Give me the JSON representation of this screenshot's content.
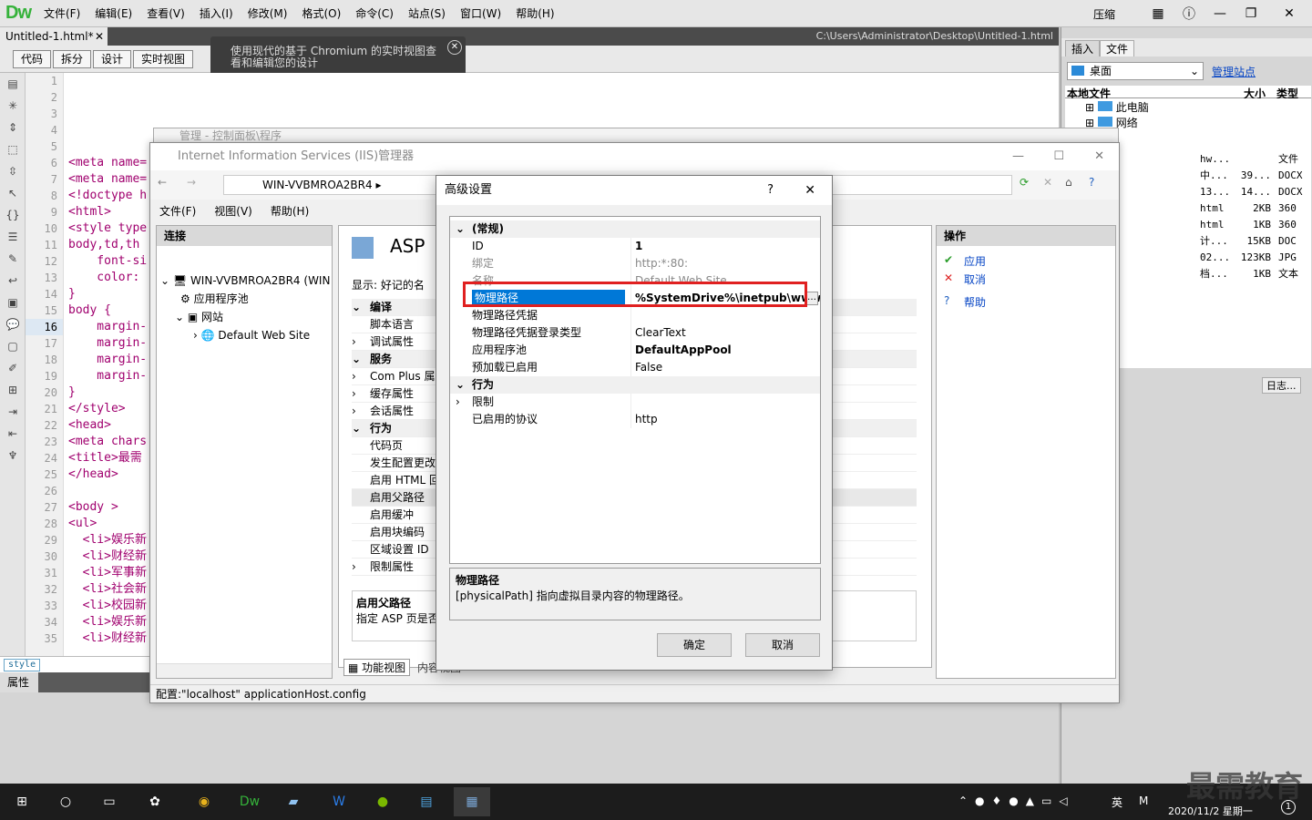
{
  "dw": {
    "logo": "Dw",
    "menu": [
      "文件(F)",
      "编辑(E)",
      "查看(V)",
      "插入(I)",
      "修改(M)",
      "格式(O)",
      "命令(C)",
      "站点(S)",
      "窗口(W)",
      "帮助(H)"
    ],
    "workspace": "压缩",
    "doc_tab": "Untitled-1.html*",
    "doc_path": "C:\\Users\\Administrator\\Desktop\\Untitled-1.html",
    "views": [
      "代码",
      "拆分",
      "设计",
      "实时视图"
    ],
    "tooltip": "使用现代的基于 Chromium 的实时视图查看和编辑您的设计",
    "line_numbers": [
      "1",
      "2",
      "3",
      "4",
      "5",
      "6",
      "7",
      "8",
      "9",
      "10",
      "11",
      "12",
      "13",
      "14",
      "15",
      "16",
      "17",
      "18",
      "19",
      "20",
      "21",
      "22",
      "23",
      "24",
      "25",
      "26",
      "27",
      "28",
      "29",
      "30",
      "31",
      "32",
      "33",
      "34",
      "35"
    ],
    "code_lines": [
      "",
      "",
      "",
      "",
      "",
      "<meta name=",
      "<meta name=",
      "<!doctype h",
      "<html>",
      "<style type",
      "body,td,th",
      "    font-si",
      "    color:",
      "}",
      "body {",
      "    margin-",
      "    margin-",
      "    margin-",
      "    margin-",
      "}",
      "</style>",
      "<head>",
      "<meta chars",
      "<title>最需",
      "</head>",
      "",
      "<body >",
      "<ul>",
      "  <li>娱乐新",
      "  <li>财经新",
      "  <li>军事新",
      "  <li>社会新",
      "  <li>校园新",
      "  <li>娱乐新",
      "  <li>财经新"
    ],
    "tag_selector": "style",
    "properties_label": "属性"
  },
  "files_panel": {
    "tabs": [
      "插入",
      "文件"
    ],
    "site": "桌面",
    "manage": "管理站点",
    "col_local": "本地文件",
    "col_size": "大小",
    "col_type": "类型",
    "tree": [
      "此电脑",
      "网络"
    ],
    "rows": [
      {
        "name": "hw...",
        "size": "",
        "type": "文件"
      },
      {
        "name": "中...",
        "size": "39...",
        "type": "DOCX"
      },
      {
        "name": "13...",
        "size": "14...",
        "type": "DOCX"
      },
      {
        "name": "html",
        "size": "2KB",
        "type": "360"
      },
      {
        "name": "html",
        "size": "1KB",
        "type": "360"
      },
      {
        "name": "计...",
        "size": "15KB",
        "type": "DOC"
      },
      {
        "name": "02...",
        "size": "123KB",
        "type": "JPG"
      },
      {
        "name": "档...",
        "size": "1KB",
        "type": "文本"
      }
    ],
    "log": "日志..."
  },
  "iis_back": "管理 - 控制面板\\程序",
  "iis": {
    "title": "Internet Information Services (IIS)管理器",
    "crumb": "WIN-VVBMROA2BR4",
    "menu": [
      "文件(F)",
      "视图(V)",
      "帮助(H)"
    ],
    "connections_label": "连接",
    "tree": {
      "server": "WIN-VVBMROA2BR4 (WIN",
      "apppools": "应用程序池",
      "sites": "网站",
      "site": "Default Web Site"
    },
    "feature_title": "ASP",
    "display_label": "显示:",
    "display_value": "好记的名",
    "feature_rows": [
      {
        "label": "编译",
        "cat": true
      },
      {
        "label": "脚本语言",
        "cat": false
      },
      {
        "label": "调试属性",
        "cat": false
      },
      {
        "label": "服务",
        "cat": true
      },
      {
        "label": "Com Plus 属",
        "cat": false
      },
      {
        "label": "缓存属性",
        "cat": false
      },
      {
        "label": "会话属性",
        "cat": false
      },
      {
        "label": "行为",
        "cat": true
      },
      {
        "label": "代码页",
        "cat": false
      },
      {
        "label": "发生配置更改",
        "cat": false
      },
      {
        "label": "启用 HTML 回",
        "cat": false
      },
      {
        "label": "启用父路径",
        "cat": false
      },
      {
        "label": "启用缓冲",
        "cat": false
      },
      {
        "label": "启用块编码",
        "cat": false
      },
      {
        "label": "区域设置 ID",
        "cat": false
      },
      {
        "label": "限制属性",
        "cat": false
      }
    ],
    "feature_desc_title": "启用父路径",
    "feature_desc_text": "指定 ASP 页是否",
    "tab_features": "功能视图",
    "tab_content": "内容视图",
    "actions_label": "操作",
    "actions": [
      "应用",
      "取消",
      "帮助"
    ],
    "status": "配置:\"localhost\" applicationHost.config"
  },
  "dialog": {
    "title": "高级设置",
    "help": "?",
    "rows": [
      {
        "k": "(常规)",
        "v": "",
        "type": "cat"
      },
      {
        "k": "ID",
        "v": "1",
        "type": "bold"
      },
      {
        "k": "绑定",
        "v": "http:*:80:",
        "type": "gray"
      },
      {
        "k": "名称",
        "v": "Default Web Site",
        "type": "gray"
      },
      {
        "k": "物理路径",
        "v": "%SystemDrive%\\inetpub\\wwwroot",
        "type": "sel"
      },
      {
        "k": "物理路径凭据",
        "v": "",
        "type": ""
      },
      {
        "k": "物理路径凭据登录类型",
        "v": "ClearText",
        "type": ""
      },
      {
        "k": "应用程序池",
        "v": "DefaultAppPool",
        "type": "bold"
      },
      {
        "k": "预加载已启用",
        "v": "False",
        "type": ""
      },
      {
        "k": "行为",
        "v": "",
        "type": "cat"
      },
      {
        "k": "限制",
        "v": "",
        "type": ""
      },
      {
        "k": "已启用的协议",
        "v": "http",
        "type": ""
      }
    ],
    "desc_title": "物理路径",
    "desc_text": "[physicalPath] 指向虚拟目录内容的物理路径。",
    "ok": "确定",
    "cancel": "取消"
  },
  "taskbar": {
    "ime": "英",
    "date": "2020/11/2 星期一",
    "notify": "1"
  },
  "watermark": "最需教育"
}
